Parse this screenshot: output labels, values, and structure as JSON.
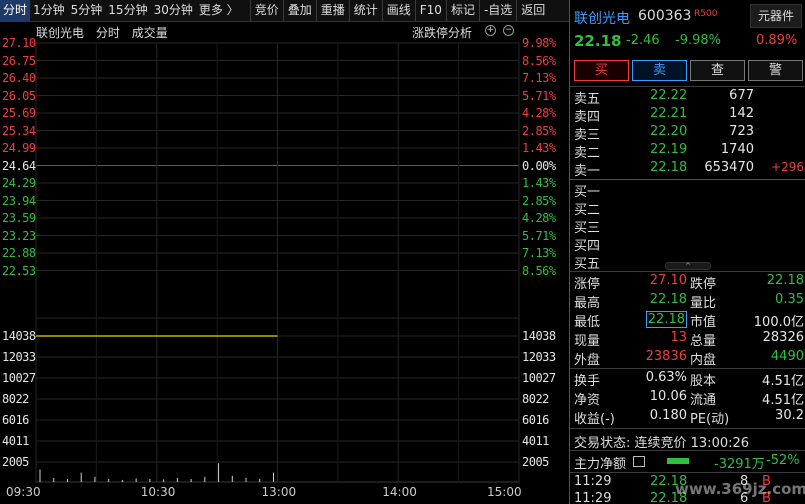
{
  "toolbar": {
    "tabs": [
      "分时",
      "1分钟",
      "5分钟",
      "15分钟",
      "30分钟",
      "更多 〉"
    ],
    "buttons": [
      "竞价",
      "叠加",
      "重播",
      "统计",
      "画线",
      "F10",
      "标记",
      "-自选",
      "返回"
    ]
  },
  "chart": {
    "stock_name": "联创光电",
    "mode": "分时",
    "volume_label": "成交量",
    "limit_analysis": "涨跌停分析",
    "zoom_in_symbol": "+",
    "zoom_out_symbol": "−"
  },
  "chart_data": {
    "type": "line",
    "price_axis": [
      "27.10",
      "26.75",
      "26.40",
      "26.05",
      "25.69",
      "25.34",
      "24.99",
      "24.64",
      "24.29",
      "23.94",
      "23.59",
      "23.23",
      "22.88",
      "22.53"
    ],
    "pct_axis": [
      "9.98%",
      "8.56%",
      "7.13%",
      "5.71%",
      "4.28%",
      "2.85%",
      "1.43%",
      "0.00%",
      "1.43%",
      "2.85%",
      "4.28%",
      "5.71%",
      "7.13%",
      "8.56%"
    ],
    "price_axis_colors": [
      "red",
      "red",
      "red",
      "red",
      "red",
      "red",
      "red",
      "white",
      "green",
      "green",
      "green",
      "green",
      "green",
      "green"
    ],
    "volume_axis": [
      "14038",
      "12033",
      "10027",
      "8022",
      "6016",
      "4011",
      "2005"
    ],
    "time_axis": [
      "09:30",
      "10:30",
      "13:00",
      "14:00",
      "15:00"
    ],
    "prev_close": 24.64,
    "volume_line_level": 14038,
    "volume_bars": [
      1200,
      400,
      300,
      900,
      500,
      300,
      200,
      350,
      300,
      250,
      400,
      300,
      500,
      1800,
      600,
      400,
      300,
      900
    ]
  },
  "quote": {
    "name": "联创光电",
    "code": "600363",
    "badge": "R500",
    "component_button": "元器件",
    "price": "22.18",
    "change": "-2.46",
    "change_pct": "-9.98%",
    "component_pct": "0.89%"
  },
  "actions": {
    "buy": "买",
    "sell": "卖",
    "query": "查",
    "alert": "警"
  },
  "asks": [
    {
      "label": "卖五",
      "price": "22.22",
      "volume": "677",
      "change": ""
    },
    {
      "label": "卖四",
      "price": "22.21",
      "volume": "142",
      "change": ""
    },
    {
      "label": "卖三",
      "price": "22.20",
      "volume": "723",
      "change": ""
    },
    {
      "label": "卖二",
      "price": "22.19",
      "volume": "1740",
      "change": ""
    },
    {
      "label": "卖一",
      "price": "22.18",
      "volume": "653470",
      "change": "+296"
    }
  ],
  "bids": [
    {
      "label": "买一"
    },
    {
      "label": "买二"
    },
    {
      "label": "买三"
    },
    {
      "label": "买四"
    },
    {
      "label": "买五"
    }
  ],
  "stats": [
    {
      "l1": "涨停",
      "v1": "27.10",
      "c1": "red",
      "l2": "跌停",
      "v2": "22.18",
      "c2": "green"
    },
    {
      "l1": "最高",
      "v1": "22.18",
      "c1": "green",
      "l2": "量比",
      "v2": "0.35",
      "c2": "green"
    },
    {
      "l1": "最低",
      "v1": "22.18",
      "c1": "green",
      "l2": "市值",
      "v2": "100.0亿",
      "c2": "white"
    },
    {
      "l1": "现量",
      "v1": "13",
      "c1": "red",
      "l2": "总量",
      "v2": "28326",
      "c2": "white"
    },
    {
      "l1": "外盘",
      "v1": "23836",
      "c1": "red",
      "l2": "内盘",
      "v2": "4490",
      "c2": "green"
    },
    {
      "l1": "换手",
      "v1": "0.63%",
      "c1": "white",
      "l2": "股本",
      "v2": "4.51亿",
      "c2": "white"
    },
    {
      "l1": "净资",
      "v1": "10.06",
      "c1": "white",
      "l2": "流通",
      "v2": "4.51亿",
      "c2": "white"
    },
    {
      "l1": "收益(-)",
      "v1": "0.180",
      "c1": "white",
      "l2": "PE(动)",
      "v2": "30.2",
      "c2": "white"
    }
  ],
  "status": "交易状态: 连续竞价 13:00:26",
  "main_flow": {
    "label": "主力净额",
    "value": "-3291万",
    "pct": "-52%"
  },
  "ticks": [
    {
      "time": "11:29",
      "price": "22.18",
      "volume": "8",
      "side": "B"
    },
    {
      "time": "11:29",
      "price": "22.18",
      "volume": "6",
      "side": "B"
    }
  ],
  "watermark": "www.369jz.com"
}
